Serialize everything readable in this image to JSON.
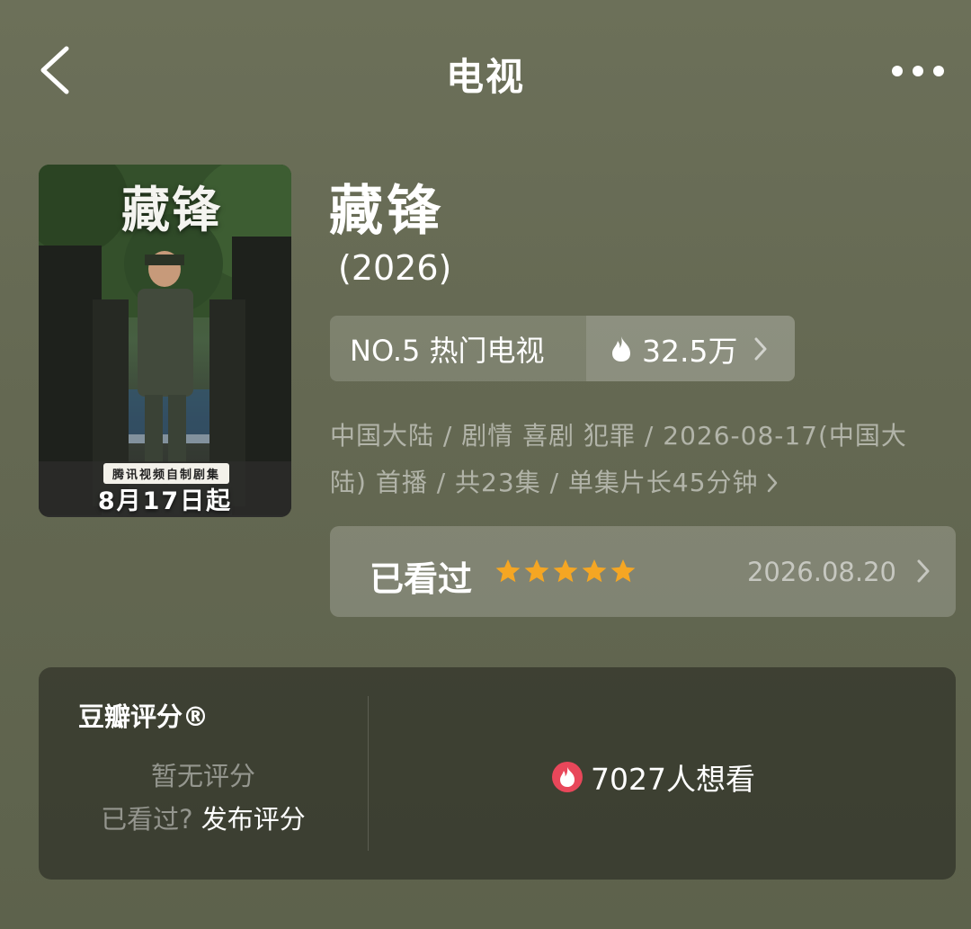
{
  "nav": {
    "title": "电视",
    "back_icon": "chevron-left-icon",
    "more_icon": "more-horizontal-icon"
  },
  "poster": {
    "title": "藏锋",
    "badge": "腾讯视频自制剧集",
    "date": "8月17日起"
  },
  "show": {
    "title": "藏锋",
    "year": "(2026)"
  },
  "rank": {
    "label": "NO.5 热门电视",
    "heat": "32.5万",
    "heat_icon": "flame-icon"
  },
  "meta": {
    "line1": "中国大陆 / 剧情 喜剧 犯罪 / 2026-08-17(中国大",
    "line2": "陆) 首播 / 共23集 / 单集片长45分钟"
  },
  "watched": {
    "label": "已看过",
    "stars": 5,
    "date": "2026.08.20",
    "star_color": "#f5a623"
  },
  "rating": {
    "brand": "豆瓣评分®",
    "no_rating": "暂无评分",
    "seen_question": "已看过?",
    "publish": "发布评分",
    "want_count": "7027人想看",
    "want_icon_color": "#e8475a"
  }
}
